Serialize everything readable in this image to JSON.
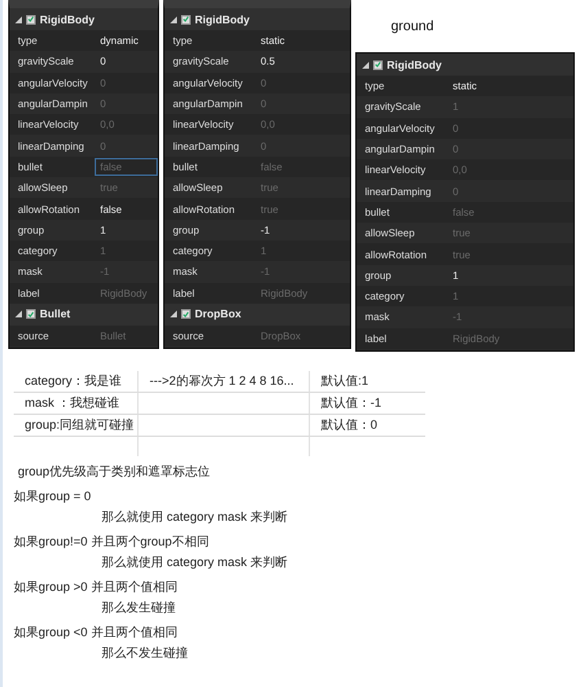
{
  "inspectors": [
    {
      "sections": [
        {
          "name": "RigidBody",
          "checked": true,
          "expanded": true,
          "props": [
            {
              "name": "type",
              "value": "dynamic",
              "dim": false,
              "focused": false
            },
            {
              "name": "gravityScale",
              "value": "0",
              "dim": false,
              "focused": false
            },
            {
              "name": "angularVelocity",
              "value": "0",
              "dim": true,
              "focused": false
            },
            {
              "name": "angularDampin",
              "value": "0",
              "dim": true,
              "focused": false
            },
            {
              "name": "linearVelocity",
              "value": "0,0",
              "dim": true,
              "focused": false
            },
            {
              "name": "linearDamping",
              "value": "0",
              "dim": true,
              "focused": false
            },
            {
              "name": "bullet",
              "value": "false",
              "dim": true,
              "focused": true
            },
            {
              "name": "allowSleep",
              "value": "true",
              "dim": true,
              "focused": false
            },
            {
              "name": "allowRotation",
              "value": "false",
              "dim": false,
              "focused": false
            },
            {
              "name": "group",
              "value": "1",
              "dim": false,
              "focused": false
            },
            {
              "name": "category",
              "value": "1",
              "dim": true,
              "focused": false
            },
            {
              "name": "mask",
              "value": "-1",
              "dim": true,
              "focused": false
            },
            {
              "name": "label",
              "value": "RigidBody",
              "dim": true,
              "focused": false
            }
          ]
        },
        {
          "name": "Bullet",
          "checked": true,
          "expanded": true,
          "props": [
            {
              "name": "source",
              "value": "Bullet",
              "dim": true,
              "focused": false
            }
          ]
        }
      ]
    },
    {
      "sections": [
        {
          "name": "RigidBody",
          "checked": true,
          "expanded": true,
          "props": [
            {
              "name": "type",
              "value": "static",
              "dim": false,
              "focused": false
            },
            {
              "name": "gravityScale",
              "value": "0.5",
              "dim": false,
              "focused": false
            },
            {
              "name": "angularVelocity",
              "value": "0",
              "dim": true,
              "focused": false
            },
            {
              "name": "angularDampin",
              "value": "0",
              "dim": true,
              "focused": false
            },
            {
              "name": "linearVelocity",
              "value": "0,0",
              "dim": true,
              "focused": false
            },
            {
              "name": "linearDamping",
              "value": "0",
              "dim": true,
              "focused": false
            },
            {
              "name": "bullet",
              "value": "false",
              "dim": true,
              "focused": false
            },
            {
              "name": "allowSleep",
              "value": "true",
              "dim": true,
              "focused": false
            },
            {
              "name": "allowRotation",
              "value": "true",
              "dim": true,
              "focused": false
            },
            {
              "name": "group",
              "value": "-1",
              "dim": false,
              "focused": false
            },
            {
              "name": "category",
              "value": "1",
              "dim": true,
              "focused": false
            },
            {
              "name": "mask",
              "value": "-1",
              "dim": true,
              "focused": false
            },
            {
              "name": "label",
              "value": "RigidBody",
              "dim": true,
              "focused": false
            }
          ]
        },
        {
          "name": "DropBox",
          "checked": true,
          "expanded": true,
          "props": [
            {
              "name": "source",
              "value": "DropBox",
              "dim": true,
              "focused": false
            }
          ]
        }
      ]
    },
    {
      "title": "ground",
      "sections": [
        {
          "name": "RigidBody",
          "checked": true,
          "expanded": true,
          "props": [
            {
              "name": "type",
              "value": "static",
              "dim": false,
              "focused": false
            },
            {
              "name": "gravityScale",
              "value": "1",
              "dim": true,
              "focused": false
            },
            {
              "name": "angularVelocity",
              "value": "0",
              "dim": true,
              "focused": false
            },
            {
              "name": "angularDampin",
              "value": "0",
              "dim": true,
              "focused": false
            },
            {
              "name": "linearVelocity",
              "value": "0,0",
              "dim": true,
              "focused": false
            },
            {
              "name": "linearDamping",
              "value": "0",
              "dim": true,
              "focused": false
            },
            {
              "name": "bullet",
              "value": "false",
              "dim": true,
              "focused": false
            },
            {
              "name": "allowSleep",
              "value": "true",
              "dim": true,
              "focused": false
            },
            {
              "name": "allowRotation",
              "value": "true",
              "dim": true,
              "focused": false
            },
            {
              "name": "group",
              "value": "1",
              "dim": false,
              "focused": false
            },
            {
              "name": "category",
              "value": "1",
              "dim": true,
              "focused": false
            },
            {
              "name": "mask",
              "value": "-1",
              "dim": true,
              "focused": false
            },
            {
              "name": "label",
              "value": "RigidBody",
              "dim": true,
              "focused": false
            }
          ]
        }
      ]
    }
  ],
  "table": {
    "rows": [
      {
        "column_1": "category：我是谁",
        "column_2": "--->2的幂次方 1 2 4 8 16...",
        "column_3": "默认值:1"
      },
      {
        "column_1": "mask ：我想碰谁",
        "column_3": "默认值：-1"
      },
      {
        "column_1": "group:同组就可碰撞",
        "column_3": "默认值：0"
      }
    ]
  },
  "notes": [
    {
      "kind": "heading",
      "text": "group优先级高于类别和遮罩标志位"
    },
    {
      "kind": "condition",
      "text": "如果group = 0"
    },
    {
      "kind": "result",
      "text": "那么就使用 category  mask 来判断"
    },
    {
      "kind": "condition",
      "text": "如果group!=0  并且两个group不相同"
    },
    {
      "kind": "result",
      "text": "那么就使用 category  mask 来判断"
    },
    {
      "kind": "condition",
      "text": "如果group >0  并且两个值相同"
    },
    {
      "kind": "result",
      "text": "那么发生碰撞"
    },
    {
      "kind": "condition",
      "text": "如果group <0  并且两个值相同"
    },
    {
      "kind": "result",
      "text": "那么不发生碰撞"
    }
  ]
}
